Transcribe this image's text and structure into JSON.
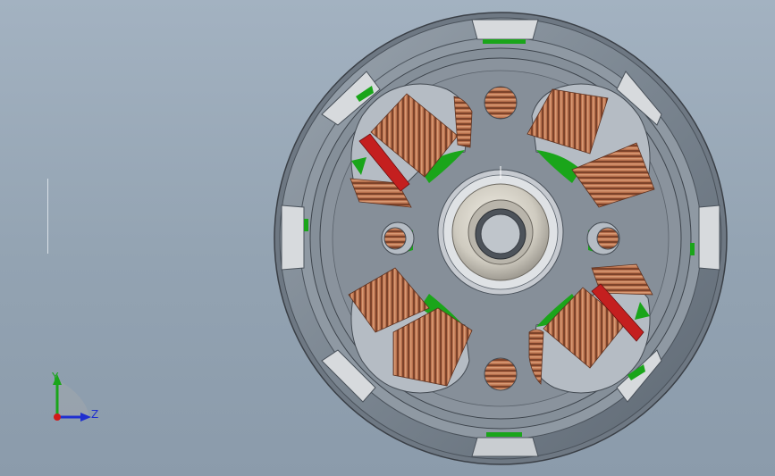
{
  "app": {
    "view": "cad-3d-viewport",
    "model": "outrunner-motor-stator-assembly"
  },
  "colors": {
    "background_top": "#a3b2c1",
    "background_bottom": "#8b9bab",
    "housing": "#7c8793",
    "stator": "#848d97",
    "copper": "#b26a48",
    "green_magnet": "#1aa51a",
    "red_wire": "#c41f1f",
    "bearing": "#d6d3c9"
  },
  "axis_triad": {
    "y_label": "Y",
    "z_label": "Z",
    "y_color": "#1aa51a",
    "z_color": "#1f2fd0",
    "origin_color": "#d21a1a"
  }
}
